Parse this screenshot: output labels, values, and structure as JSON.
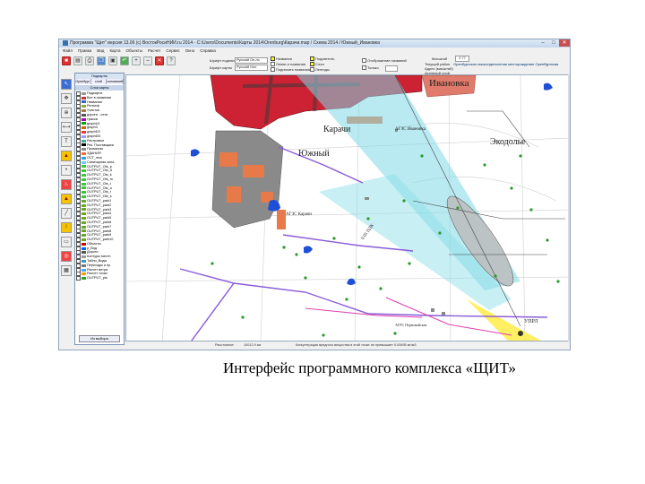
{
  "window": {
    "title": "Программа \"Щит\" версия 13.06 (c) ВостокРосиНИИ.ru 2014 - C:\\Users\\Documents\\Карты 2014\\Orenburg\\Карачи.map / Схема 2014 / Южный_Ивановка",
    "minimize": "–",
    "maximize": "□",
    "close": "✕"
  },
  "menu": [
    "Файл",
    "Правка",
    "Вид",
    "Карта",
    "Объекты",
    "Расчет",
    "Сервис",
    "Окно",
    "Справка"
  ],
  "toolbar": {
    "icons": [
      "save-icon",
      "open-icon",
      "print-icon",
      "copy-icon",
      "paste-icon",
      "undo-icon",
      "zoom-in-icon",
      "zoom-out-icon",
      "close-icon",
      "help-icon"
    ]
  },
  "ribbon": {
    "font_label": "Шрифт подписей",
    "font_value": "Русский Оп-ло",
    "map_font_label": "Шрифт карты",
    "map_font_value": "Русский Опл",
    "checks_col1": [
      "Названия",
      "Линии и названия",
      "Подписать названия"
    ],
    "checks_col2": [
      "Подсветить",
      "Слои",
      "Легенды"
    ],
    "checks_col3": [
      "Отображение названий",
      "Только"
    ],
    "scale_label": "Масштаб",
    "scale_value": "2.77",
    "right_labels": [
      "Текущий район",
      "Адрес (масштаб)",
      "Активный слой"
    ],
    "right_info": "Оренбургская газоконденсатная месторождение Оренбургская"
  },
  "panel": {
    "title": "Подкарты",
    "tabs": [
      "Оренбург",
      "слой",
      "оснований"
    ],
    "layers_header": "Слои карты",
    "layers": [
      {
        "label": "Подкарты",
        "color": "#999999"
      },
      {
        "label": "Все в названия",
        "color": "#cc3333"
      },
      {
        "label": "Названия",
        "color": "#3366cc"
      },
      {
        "label": "Рельеф",
        "color": "#88aa44"
      },
      {
        "label": "Участки",
        "color": "#aa7744"
      },
      {
        "label": "дороги - сети",
        "color": "#555555"
      },
      {
        "label": "трасса",
        "color": "#aa00aa"
      },
      {
        "label": "graphU1",
        "color": "#00aa00"
      },
      {
        "label": "graph3",
        "color": "#cc6600"
      },
      {
        "label": "graphD3",
        "color": "#ff3333"
      },
      {
        "label": "graphDD",
        "color": "#9999ff"
      },
      {
        "label": "Растровые",
        "color": "#44aa99"
      },
      {
        "label": "Рек. Поставщики",
        "color": "#000000"
      },
      {
        "label": "Промзоны",
        "color": "#888888"
      },
      {
        "label": "ЗДАНИЯ",
        "color": "#ff6633"
      },
      {
        "label": "ОСТ_mxs",
        "color": "#3399ff"
      },
      {
        "label": "Санитарная зона",
        "color": "#66ccff"
      },
      {
        "label": "OUTPUT_Ots_p",
        "color": "#33cc33"
      },
      {
        "label": "OUTPUT_Ots_d",
        "color": "#33cc33"
      },
      {
        "label": "OUTPUT_Ots_k",
        "color": "#33cc33"
      },
      {
        "label": "OUTPUT_Ots_m",
        "color": "#33cc33"
      },
      {
        "label": "OUTPUT_Ots_t",
        "color": "#33cc33"
      },
      {
        "label": "OUTPUT_Ots_u",
        "color": "#33cc33"
      },
      {
        "label": "OUTPUT_Ots_r",
        "color": "#33cc33"
      },
      {
        "label": "OUTPUT_Ots_s",
        "color": "#33cc33"
      },
      {
        "label": "OUTPUT_park1",
        "color": "#66aa22"
      },
      {
        "label": "OUTPUT_park2",
        "color": "#66aa22"
      },
      {
        "label": "OUTPUT_park3",
        "color": "#66aa22"
      },
      {
        "label": "OUTPUT_park4",
        "color": "#66aa22"
      },
      {
        "label": "OUTPUT_park5",
        "color": "#66aa22"
      },
      {
        "label": "OUTPUT_park6",
        "color": "#66aa22"
      },
      {
        "label": "OUTPUT_park7",
        "color": "#66aa22"
      },
      {
        "label": "OUTPUT_park8",
        "color": "#66aa22"
      },
      {
        "label": "OUTPUT_park9",
        "color": "#66aa22"
      },
      {
        "label": "OUTPUT_park10",
        "color": "#66aa22"
      },
      {
        "label": "Объекты",
        "color": "#cc0000"
      },
      {
        "label": "р_Вод",
        "color": "#0066ff"
      },
      {
        "label": "Дороги",
        "color": "#555555"
      },
      {
        "label": "Контуры местн",
        "color": "#999999"
      },
      {
        "label": "Табли_Воды",
        "color": "#3399cc"
      },
      {
        "label": "Переходы и пр",
        "color": "#777777"
      },
      {
        "label": "Расчет ветра",
        "color": "#44aaff"
      },
      {
        "label": "Расчет точки",
        "color": "#ff9900"
      },
      {
        "label": "OUTPUT_pts",
        "color": "#22aa22"
      }
    ],
    "button": "Из выбора"
  },
  "map": {
    "labels": {
      "ivanovka": "Ивановка",
      "karachi": "Карачи",
      "uzhny": "Южный",
      "ekodolye": "Экодолье",
      "agzs_ivanovka": "АГЗС Ивановка",
      "agzs_karachi": "АГЗС Карачи",
      "pdk": "0.05 ПДК",
      "uprl": "УПРЛ",
      "station": "АГРС Первомайская"
    }
  },
  "status": {
    "left": "Расстояние:",
    "dist": "10012.9 км",
    "center": "Концентрация вредного вещества в этой точке не превышает 0.00695 мг/м3"
  },
  "caption": "Интерфейс программного комплекса «ЩИТ»"
}
